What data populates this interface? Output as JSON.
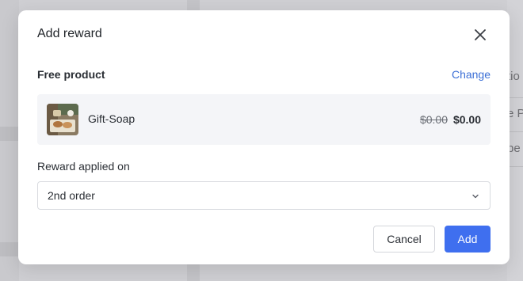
{
  "background": {
    "peek_lines": [
      "tio",
      "e P",
      "pe"
    ]
  },
  "modal": {
    "title": "Add reward",
    "close_icon": "close-icon"
  },
  "free_product": {
    "label": "Free product",
    "change_link": "Change",
    "product": {
      "name": "Gift-Soap",
      "original_price": "$0.00",
      "price": "$0.00",
      "thumbnail_icon": "product-image"
    }
  },
  "reward_applied": {
    "label": "Reward applied on",
    "selected": "2nd order",
    "chevron_icon": "chevron-down-icon"
  },
  "actions": {
    "cancel_label": "Cancel",
    "add_label": "Add"
  },
  "colors": {
    "primary": "#3f6fef",
    "link": "#3b6fd6",
    "overlay": "#cfcfd3"
  }
}
